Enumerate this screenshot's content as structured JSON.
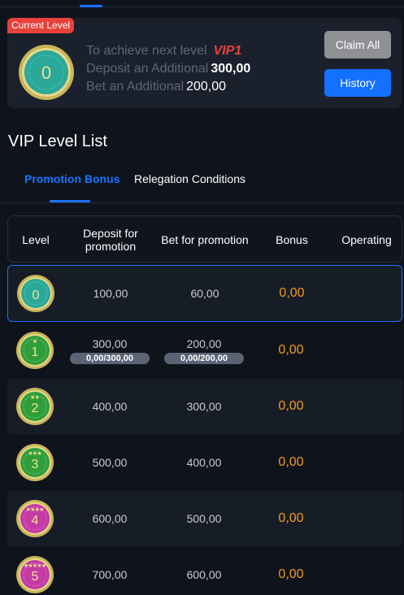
{
  "current": {
    "badge": "Current Level",
    "level_number": "0",
    "line1_text": "To achieve next level",
    "next_level": "VIP1",
    "line2_text": "Deposit an Additional",
    "deposit_additional": "300,00",
    "line3_text": "Bet an Additional",
    "bet_additional": "200,00",
    "claim_all_label": "Claim All",
    "history_label": "History"
  },
  "section_title": "VIP Level List",
  "tabs": {
    "promotion": "Promotion Bonus",
    "relegation": "Relegation Conditions"
  },
  "table": {
    "headers": {
      "level": "Level",
      "deposit": "Deposit for promotion",
      "bet": "Bet for promotion",
      "bonus": "Bonus",
      "operating": "Operating"
    },
    "rows": [
      {
        "level": "0",
        "stars": 0,
        "color": "#2aa89a",
        "deposit": "100,00",
        "deposit_progress": "",
        "bet": "60,00",
        "bet_progress": "",
        "bonus": "0,00"
      },
      {
        "level": "1",
        "stars": 1,
        "color": "#2f9e3a",
        "deposit": "300,00",
        "deposit_progress": "0,00/300,00",
        "bet": "200,00",
        "bet_progress": "0,00/200,00",
        "bonus": "0,00"
      },
      {
        "level": "2",
        "stars": 2,
        "color": "#2f9e3a",
        "deposit": "400,00",
        "deposit_progress": "",
        "bet": "300,00",
        "bet_progress": "",
        "bonus": "0,00"
      },
      {
        "level": "3",
        "stars": 3,
        "color": "#2f9e3a",
        "deposit": "500,00",
        "deposit_progress": "",
        "bet": "400,00",
        "bet_progress": "",
        "bonus": "0,00"
      },
      {
        "level": "4",
        "stars": 4,
        "color": "#c43aa6",
        "deposit": "600,00",
        "deposit_progress": "",
        "bet": "500,00",
        "bet_progress": "",
        "bonus": "0,00"
      },
      {
        "level": "5",
        "stars": 5,
        "color": "#c43aa6",
        "deposit": "700,00",
        "deposit_progress": "",
        "bet": "600,00",
        "bet_progress": "",
        "bonus": "0,00"
      }
    ]
  },
  "colors": {
    "accent": "#1a73ff",
    "badge": "#e8413a",
    "bonus": "#f39a1a",
    "gold_ring": "#d9c36a"
  }
}
